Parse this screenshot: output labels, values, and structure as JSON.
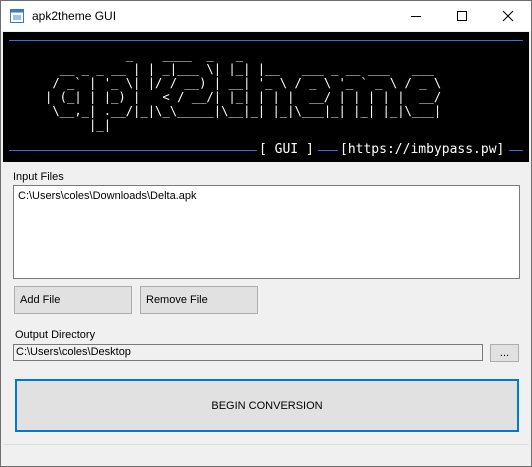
{
  "window": {
    "title": "apk2theme GUI"
  },
  "banner": {
    "ascii": "           _    ____  _   _\n  __ _ _ __ | | _|___ \\| |_| |__   ___ _ __ ___   ___\n / _` | '_ \\| |/ / __) | __| '_ \\ / _ \\ '_ ` _ \\ / _ \\\n| (_| | |_) |   < / __/| |_| | | |  __/ | | | | |  __/\n \\__,_| .__/|_|\\_\\_____|\\__|_| |_|\\___|_| |_| |_|\\___|\n      |_|",
    "gui_label": "[ GUI ]",
    "url_label": "[https://imbypass.pw]"
  },
  "input_files": {
    "label": "Input Files",
    "items": [
      "C:\\Users\\coles\\Downloads\\Delta.apk"
    ],
    "add_label": "Add File",
    "remove_label": "Remove File"
  },
  "output": {
    "label": "Output Directory",
    "value": "C:\\Users\\coles\\Desktop",
    "browse_label": "..."
  },
  "begin_label": "BEGIN CONVERSION"
}
